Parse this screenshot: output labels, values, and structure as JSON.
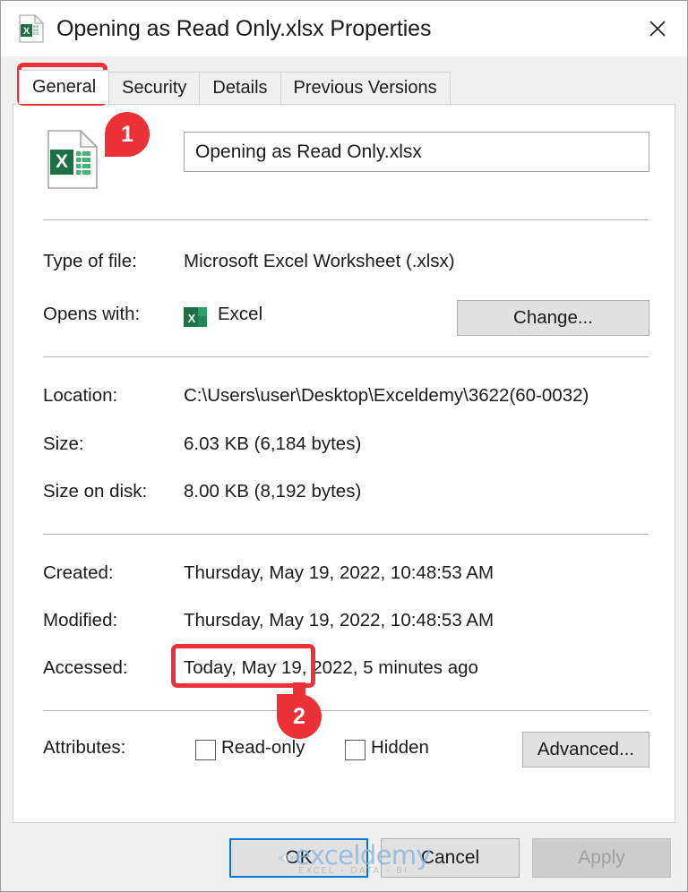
{
  "window": {
    "title": "Opening as Read Only.xlsx Properties",
    "icon": "excel-file-icon",
    "close_label": "✕"
  },
  "tabs": [
    {
      "label": "General",
      "active": true
    },
    {
      "label": "Security",
      "active": false
    },
    {
      "label": "Details",
      "active": false
    },
    {
      "label": "Previous Versions",
      "active": false
    }
  ],
  "general": {
    "filename_value": "Opening as Read Only.xlsx",
    "rows": [
      {
        "key": "Type of file:",
        "value": "Microsoft Excel Worksheet (.xlsx)"
      },
      {
        "key": "Opens with:",
        "value": "Excel"
      },
      {
        "key": "Location:",
        "value": "C:\\Users\\user\\Desktop\\Exceldemy\\3622(60-0032)"
      },
      {
        "key": "Size:",
        "value": "6.03 KB (6,184 bytes)"
      },
      {
        "key": "Size on disk:",
        "value": "8.00 KB (8,192 bytes)"
      },
      {
        "key": "Created:",
        "value": "Thursday, May 19, 2022, 10:48:53 AM"
      },
      {
        "key": "Modified:",
        "value": "Thursday, May 19, 2022, 10:48:53 AM"
      },
      {
        "key": "Accessed:",
        "value": "Today, May 19, 2022, 5 minutes ago"
      },
      {
        "key": "Attributes:",
        "value": ""
      }
    ],
    "change_button": "Change...",
    "advanced_button": "Advanced...",
    "attributes": {
      "read_only": {
        "label": "Read-only",
        "checked": false
      },
      "hidden": {
        "label": "Hidden",
        "checked": false
      }
    }
  },
  "footer": {
    "ok": "OK",
    "cancel": "Cancel",
    "apply": "Apply"
  },
  "annotations": {
    "accent_color": "#ed3237",
    "callouts": [
      {
        "number": "1",
        "target": "general-tab"
      },
      {
        "number": "2",
        "target": "read-only-checkbox"
      }
    ]
  },
  "watermark": {
    "primary": "exceldemy",
    "secondary": "EXCEL - DATA - BI"
  }
}
